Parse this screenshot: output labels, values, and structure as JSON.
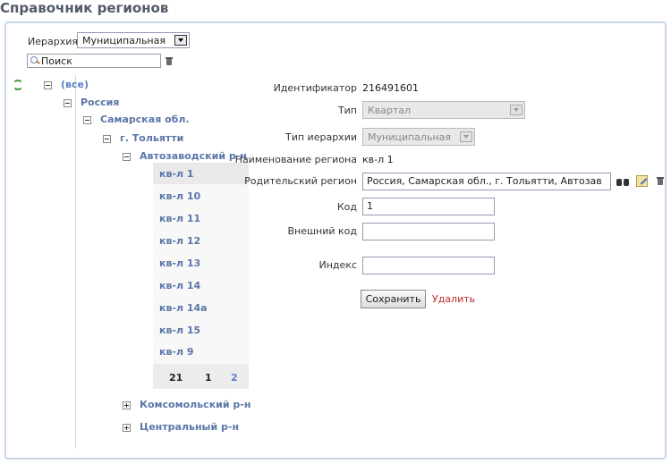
{
  "page": {
    "title": "Справочник регионов"
  },
  "hierarchy": {
    "label": "Иерархия",
    "selected": "Муниципальная"
  },
  "search": {
    "placeholder": "Поиск"
  },
  "tree": {
    "root": "(все)",
    "country": "Россия",
    "region": "Самарская обл.",
    "city": "г. Тольятти",
    "districts": [
      "Автозаводский р-н",
      "Комсомольский р-н",
      "Центральный р-н"
    ],
    "items": [
      "кв-л 1",
      "кв-л 10",
      "кв-л 11",
      "кв-л 12",
      "кв-л 13",
      "кв-л 14",
      "кв-л 14а",
      "кв-л 15",
      "кв-л 9"
    ],
    "pager": {
      "total": "21",
      "current": "1",
      "next": "2"
    }
  },
  "form": {
    "identifier": {
      "label": "Идентификатор",
      "value": "216491601"
    },
    "type": {
      "label": "Тип",
      "value": "Квартал"
    },
    "hierarchy_type": {
      "label": "Тип иерархии",
      "value": "Муниципальная"
    },
    "name": {
      "label": "Наименование региона",
      "value": "кв-л 1"
    },
    "parent": {
      "label": "Родительский регион",
      "value": "Россия, Самарская обл., г. Тольятти, Автозав"
    },
    "code": {
      "label": "Код",
      "value": "1"
    },
    "external_code": {
      "label": "Внешний код",
      "value": ""
    },
    "index": {
      "label": "Индекс",
      "value": ""
    },
    "save_label": "Сохранить",
    "delete_label": "Удалить"
  },
  "icons": [
    "refresh-icon",
    "search-icon",
    "trash-icon",
    "binoculars-icon",
    "edit-icon"
  ],
  "colors": {
    "link": "#5b76a8",
    "delete": "#c0282a",
    "panel_border": "#c8d6e8"
  }
}
